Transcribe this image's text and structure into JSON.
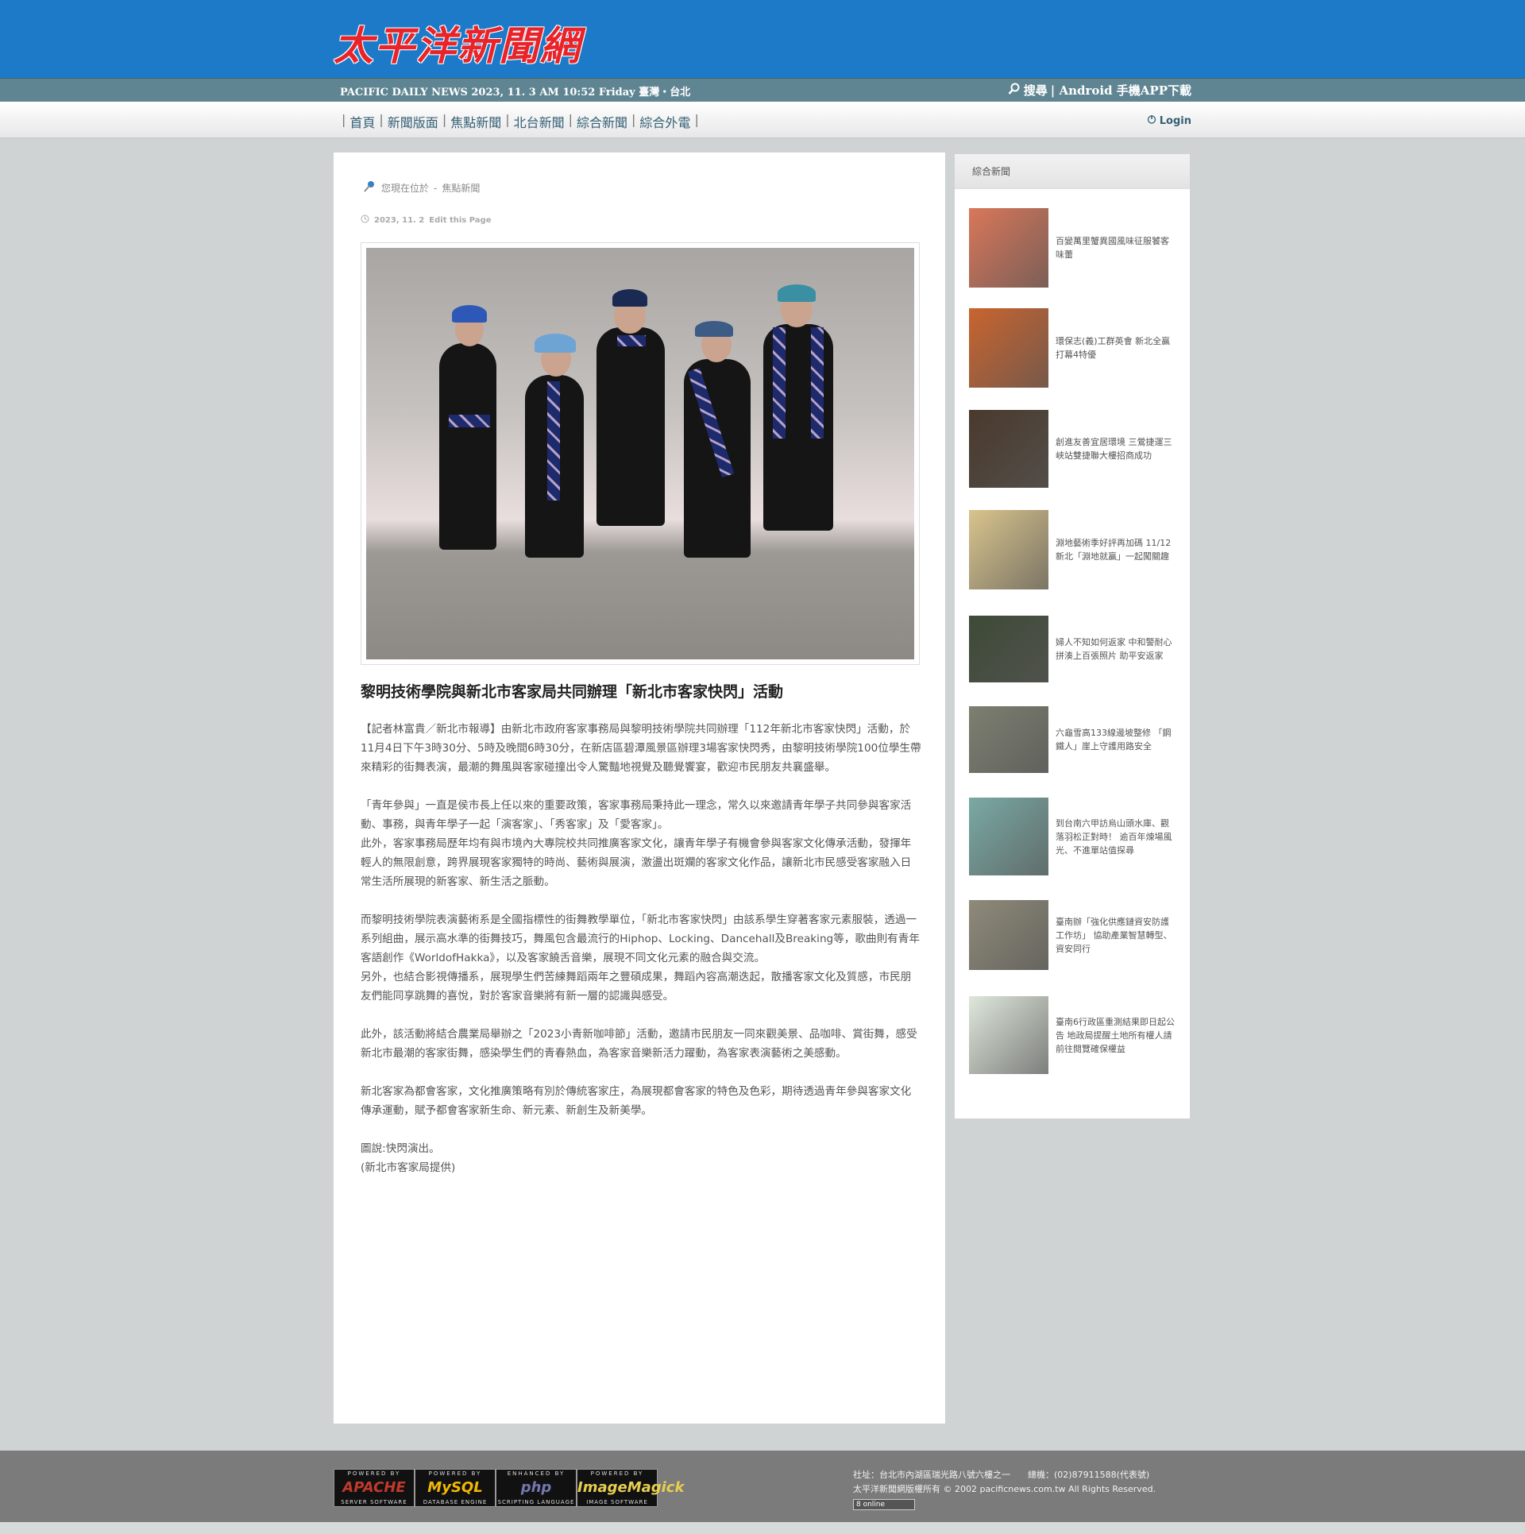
{
  "header": {
    "logo_text": "太平洋新聞網",
    "date_line": "PACIFIC DAILY NEWS 2023, 11. 3 AM 10:52 Friday  臺灣‧台北",
    "search_label": "搜尋",
    "app_label": "| Android 手機APP下載",
    "login_label": "Login"
  },
  "nav": {
    "items": [
      "首頁",
      "新聞版面",
      "焦點新聞",
      "北台新聞",
      "綜合新聞",
      "綜合外電"
    ]
  },
  "breadcrumb": {
    "prefix": "您現在位於",
    "separator": "-",
    "section": "焦點新聞"
  },
  "article": {
    "date": "2023, 11. 2",
    "edit_label": "Edit this Page",
    "title": "黎明技術學院與新北市客家局共同辦理「新北市客家快閃」活動",
    "paragraphs": [
      "【記者林富貴／新北市報導】由新北市政府客家事務局與黎明技術學院共同辦理「112年新北市客家快閃」活動，於11月4日下午3時30分、5時及晚間6時30分，在新店區碧潭風景區辦理3場客家快閃秀，由黎明技術學院100位學生帶來精彩的街舞表演，最潮的舞風與客家碰撞出令人驚豔地視覺及聽覺饗宴，歡迎市民朋友共襄盛舉。",
      "「青年參與」一直是侯市長上任以來的重要政策，客家事務局秉持此一理念，常久以來邀請青年學子共同參與客家活動、事務，與青年學子一起「演客家」、「秀客家」及「愛客家」。\n此外，客家事務局歷年均有與市境內大專院校共同推廣客家文化，讓青年學子有機會參與客家文化傳承活動，發揮年輕人的無限創意，跨界展現客家獨特的時尚、藝術與展演，激盪出斑斕的客家文化作品，讓新北市民感受客家融入日常生活所展現的新客家、新生活之脈動。",
      "而黎明技術學院表演藝術系是全國指標性的街舞教學單位，「新北市客家快閃」由該系學生穿著客家元素服裝，透過一系列組曲，展示高水準的街舞技巧，舞風包含最流行的Hiphop、Locking、Dancehall及Breaking等，歌曲則有青年客語創作《WorldofHakka》，以及客家饒舌音樂，展現不同文化元素的融合與交流。\n另外，也結合影視傳播系，展現學生們苦練舞蹈兩年之豐碩成果，舞蹈內容高潮迭起，散播客家文化及質感，市民朋友們能同享跳舞的喜悅，對於客家音樂將有新一層的認識與感受。",
      "此外，該活動將結合農業局舉辦之「2023小青新咖啡節」活動，邀請市民朋友一同來觀美景、品咖啡、賞街舞，感受新北市最潮的客家街舞，感染學生們的青春熱血，為客家音樂新活力躍動，為客家表演藝術之美感動。",
      "新北客家為都會客家，文化推廣策略有別於傳統客家庄，為展現都會客家的特色及色彩，期待透過青年參與客家文化傳承運動，賦予都會客家新生命、新元素、新創生及新美學。",
      "圖說:快閃演出。\n(新北市客家局提供)"
    ]
  },
  "sidebar": {
    "title": "綜合新聞",
    "items": [
      {
        "text": "百變萬里蟹異國風味征服饕客味蕾",
        "color": "#d9775a"
      },
      {
        "text": "環保志(義)工群英會 新北全贏打幕4特優",
        "color": "#c9642f"
      },
      {
        "text": "創進友善宜居環境 三鶯捷運三峽站雙捷聯大樓招商成功",
        "color": "#4a3a2c"
      },
      {
        "text": "淵地藝術季好評再加碼 11/12新北「淵地就贏」一起闖關趣",
        "color": "#d9c48d"
      },
      {
        "text": "婦人不知如何返家 中和警耐心拼湊上百張照片 助平安返家",
        "color": "#3f4a37"
      },
      {
        "text": "六龜雪高133線邊坡整修 「鋼鐵人」崖上守護用路安全",
        "color": "#7d7f70"
      },
      {
        "text": "到台南六甲訪烏山頭水庫、觀落羽松正對時！ 逾百年煉場風光、不進單站值探尋",
        "color": "#7aa9a4"
      },
      {
        "text": "臺南辦「強化供應鏈資安防護工作坊」 協助產業智慧轉型、資安同行",
        "color": "#8f8a79"
      },
      {
        "text": "臺南6行政區重測結果即日起公告 地政局提醒土地所有權人請前往閱覽確保權益",
        "color": "#dfe7dc"
      }
    ]
  },
  "footer": {
    "badges": [
      {
        "top": "POWERED BY",
        "name": "APACHE",
        "bottom": "SERVER SOFTWARE",
        "color": "#c0392b"
      },
      {
        "top": "POWERED BY",
        "name": "MySQL",
        "bottom": "DATABASE ENGINE",
        "color": "#f2b705"
      },
      {
        "top": "ENHANCED BY",
        "name": "php",
        "bottom": "SCRIPTING LANGUAGE",
        "color": "#7377ad"
      },
      {
        "top": "POWERED BY",
        "name": "ImageMagick",
        "bottom": "IMAGE SOFTWARE",
        "color": "#e8ce4f"
      }
    ],
    "address": "社址：台北市內湖區瑞光路八號六樓之一　　總機：(02)87911588(代表號)",
    "copyright": "太平洋新聞網版權所有 © 2002 pacificnews.com.tw All Rights Reserved.",
    "online": "8 online"
  }
}
